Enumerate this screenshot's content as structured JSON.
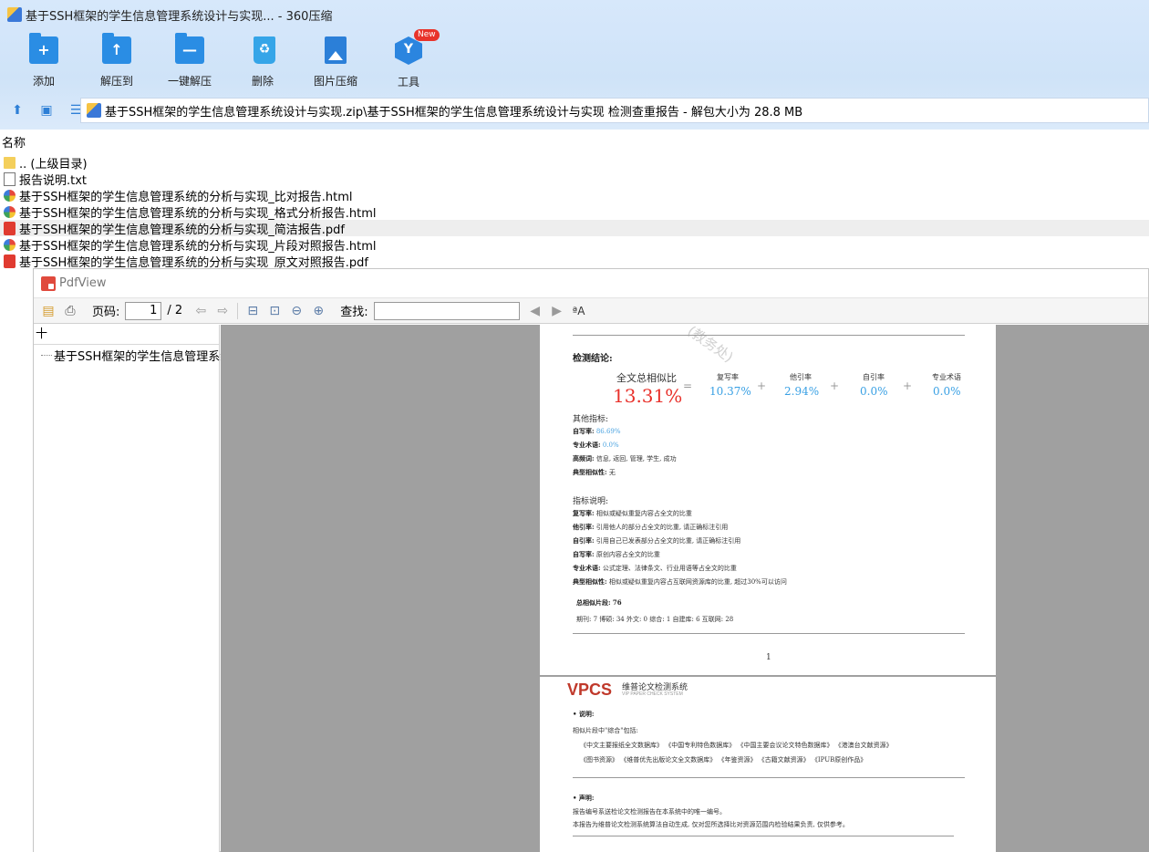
{
  "window": {
    "title": "基于SSH框架的学生信息管理系统设计与实现... - 360压缩"
  },
  "toolbar": [
    {
      "label": "添加",
      "icon": "add-icon"
    },
    {
      "label": "解压到",
      "icon": "extract-to-icon"
    },
    {
      "label": "一键解压",
      "icon": "one-click-extract-icon"
    },
    {
      "label": "删除",
      "icon": "delete-icon"
    },
    {
      "label": "图片压缩",
      "icon": "image-compress-icon"
    },
    {
      "label": "工具",
      "icon": "tools-icon",
      "badge": "New"
    }
  ],
  "address": {
    "path": "基于SSH框架的学生信息管理系统设计与实现.zip\\基于SSH框架的学生信息管理系统设计与实现 检测查重报告 - 解包大小为 28.8 MB"
  },
  "list": {
    "header": "名称",
    "files": [
      {
        "name": ".. (上级目录)",
        "type": "folder"
      },
      {
        "name": "报告说明.txt",
        "type": "txt"
      },
      {
        "name": "基于SSH框架的学生信息管理系统的分析与实现_比对报告.html",
        "type": "html"
      },
      {
        "name": "基于SSH框架的学生信息管理系统的分析与实现_格式分析报告.html",
        "type": "html"
      },
      {
        "name": "基于SSH框架的学生信息管理系统的分析与实现_简洁报告.pdf",
        "type": "pdf",
        "selected": true
      },
      {
        "name": "基于SSH框架的学生信息管理系统的分析与实现_片段对照报告.html",
        "type": "html"
      },
      {
        "name": "基于SSH框架的学生信息管理系统的分析与实现_原文对照报告.pdf",
        "type": "pdf"
      }
    ]
  },
  "pdfview": {
    "title": "PdfView",
    "page_label": "页码:",
    "page_current": "1",
    "page_total": "/ 2",
    "find_label": "查找:",
    "sidebar_search": "十",
    "outline_item": "基于SSH框架的学生信息管理系统"
  },
  "doc": {
    "watermark": "(教务处)",
    "conclusion_title": "检测结论:",
    "total_label": "全文总相似比",
    "total_value": "13.31%",
    "eq": "=",
    "plus": "+",
    "metrics": [
      {
        "label": "复写率",
        "value": "10.37%"
      },
      {
        "label": "他引率",
        "value": "2.94%"
      },
      {
        "label": "自引率",
        "value": "0.0%"
      },
      {
        "label": "专业术语",
        "value": "0.0%"
      }
    ],
    "other_title": "其他指标:",
    "other": [
      {
        "k": "自写率:",
        "v": "86.69%"
      },
      {
        "k": "专业术语:",
        "v": "0.0%"
      },
      {
        "k": "高频词:",
        "v": "信息, 返回, 管理, 学生, 成功"
      },
      {
        "k": "典型相似性:",
        "v": "无"
      }
    ],
    "explain_title": "指标说明:",
    "explain": [
      {
        "k": "复写率:",
        "v": "相似或疑似重复内容占全文的比重"
      },
      {
        "k": "他引率:",
        "v": "引用他人的部分占全文的比重, 请正确标注引用"
      },
      {
        "k": "自引率:",
        "v": "引用自己已发表部分占全文的比重, 请正确标注引用"
      },
      {
        "k": "自写率:",
        "v": "原创内容占全文的比重"
      },
      {
        "k": "专业术语:",
        "v": "公式定理、法律条文、行业用语等占全文的比重"
      },
      {
        "k": "典型相似性:",
        "v": "相似或疑似重复内容占互联网资源库的比重, 超过30%可以访问"
      }
    ],
    "segments_title": "总相似片段:",
    "segments_value": "76",
    "segments_detail": "期刊: 7  博硕: 34  外文: 0  综合: 1  自建库: 6  互联网: 28",
    "page_number": "1",
    "page2": {
      "logo": "VPCS",
      "brand": "维普论文检测系统",
      "brand_en": "VIP PAPER CHECK SYSTEM",
      "note_title": "说明:",
      "note_intro": "相似片段中\"综合\"包括:",
      "note_line1": "《中文主要报纸全文数据库》  《中国专利特色数据库》  《中国主要会议论文特色数据库》  《港澳台文献资源》",
      "note_line2": "《图书资源》  《维普优先出版论文全文数据库》  《年鉴资源》  《古籍文献资源》  《IPUB原创作品》",
      "decl_title": "声明:",
      "decl_line1": "报告编号系送检论文检测报告在本系统中的唯一编号。",
      "decl_line2": "本报告为维普论文检测系统算法自动生成, 仅对您所选择比对资源范围内检验结果负责, 仅供参考。"
    }
  }
}
